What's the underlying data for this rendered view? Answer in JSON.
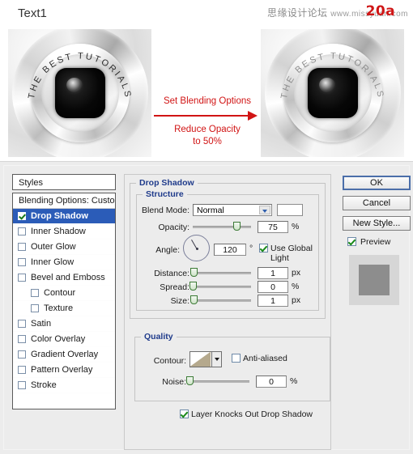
{
  "topbar": {
    "doc_title": "Text1",
    "watermark_cn": "思缘设计论坛",
    "watermark_url": "www.missyuan.com",
    "watermark_num": "20a"
  },
  "images": {
    "left_arc_text": "THE BEST TUTORIALS",
    "right_arc_text": "THE BEST TUTORIALS"
  },
  "annotation": {
    "line1": "Set Blending Options",
    "line2": "Reduce Opacity",
    "line3": "to 50%",
    "color": "#d11414"
  },
  "styles": {
    "header": "Styles",
    "items": [
      {
        "label": "Blending Options: Custom",
        "checkbox": false,
        "indent": false,
        "selected": false,
        "header_row": true
      },
      {
        "label": "Drop Shadow",
        "checkbox": true,
        "checked": true,
        "indent": false,
        "selected": true
      },
      {
        "label": "Inner Shadow",
        "checkbox": true,
        "checked": false,
        "indent": false,
        "selected": false
      },
      {
        "label": "Outer Glow",
        "checkbox": true,
        "checked": false,
        "indent": false,
        "selected": false
      },
      {
        "label": "Inner Glow",
        "checkbox": true,
        "checked": false,
        "indent": false,
        "selected": false
      },
      {
        "label": "Bevel and Emboss",
        "checkbox": true,
        "checked": false,
        "indent": false,
        "selected": false
      },
      {
        "label": "Contour",
        "checkbox": true,
        "checked": false,
        "indent": true,
        "selected": false
      },
      {
        "label": "Texture",
        "checkbox": true,
        "checked": false,
        "indent": true,
        "selected": false
      },
      {
        "label": "Satin",
        "checkbox": true,
        "checked": false,
        "indent": false,
        "selected": false
      },
      {
        "label": "Color Overlay",
        "checkbox": true,
        "checked": false,
        "indent": false,
        "selected": false
      },
      {
        "label": "Gradient Overlay",
        "checkbox": true,
        "checked": false,
        "indent": false,
        "selected": false
      },
      {
        "label": "Pattern Overlay",
        "checkbox": true,
        "checked": false,
        "indent": false,
        "selected": false
      },
      {
        "label": "Stroke",
        "checkbox": true,
        "checked": false,
        "indent": false,
        "selected": false
      }
    ],
    "selected_color": "#2b5cb8"
  },
  "drop_shadow": {
    "group_label": "Drop Shadow",
    "structure": {
      "label": "Structure",
      "blend_mode_label": "Blend Mode:",
      "blend_mode_value": "Normal",
      "color_swatch": "#ffffff",
      "opacity_label": "Opacity:",
      "opacity_value": "75",
      "opacity_unit": "%",
      "opacity_pct": 75,
      "angle_label": "Angle:",
      "angle_value": "120",
      "angle_unit": "°",
      "use_global_light": "Use Global Light",
      "use_global_light_checked": true,
      "distance_label": "Distance:",
      "distance_value": "1",
      "distance_unit": "px",
      "distance_pct": 1,
      "spread_label": "Spread:",
      "spread_value": "0",
      "spread_unit": "%",
      "spread_pct": 0,
      "size_label": "Size:",
      "size_value": "1",
      "size_unit": "px",
      "size_pct": 1
    },
    "quality": {
      "label": "Quality",
      "contour_label": "Contour:",
      "anti_aliased": "Anti-aliased",
      "anti_aliased_checked": false,
      "noise_label": "Noise:",
      "noise_value": "0",
      "noise_unit": "%",
      "noise_pct": 0
    },
    "knockout_label": "Layer Knocks Out Drop Shadow",
    "knockout_checked": true
  },
  "buttons": {
    "ok": "OK",
    "cancel": "Cancel",
    "new_style": "New Style...",
    "preview": "Preview",
    "preview_checked": true
  }
}
